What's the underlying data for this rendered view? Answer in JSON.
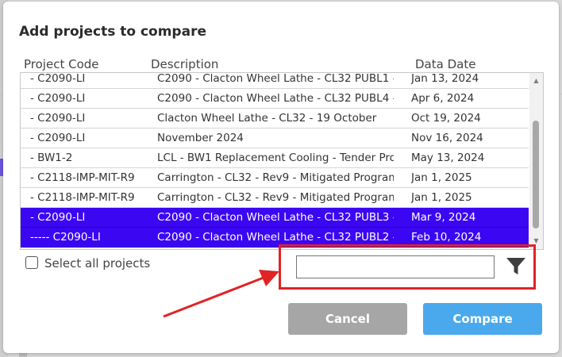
{
  "dialog": {
    "title": "Add projects to compare",
    "columns": {
      "code": "Project Code",
      "description": "Description",
      "date": "Data Date"
    },
    "rows": [
      {
        "code": "- C2090-LI",
        "description": "C2090 - Clacton Wheel Lathe - CL32 PUBL1 -",
        "date": "Jan 13, 2024",
        "selected": false
      },
      {
        "code": "- C2090-LI",
        "description": "C2090 - Clacton Wheel Lathe - CL32 PUBL4 -",
        "date": "Apr 6, 2024",
        "selected": false
      },
      {
        "code": "- C2090-LI",
        "description": "Clacton Wheel Lathe - CL32 - 19 October",
        "date": "Oct 19, 2024",
        "selected": false
      },
      {
        "code": "- C2090-LI",
        "description": "November 2024",
        "date": "Nov 16, 2024",
        "selected": false
      },
      {
        "code": "- BW1-2",
        "description": "LCL - BW1 Replacement Cooling - Tender Prog",
        "date": "May 13, 2024",
        "selected": false
      },
      {
        "code": "- C2118-IMP-MIT-R9",
        "description": "Carrington - CL32 - Rev9 - Mitigated Programm",
        "date": "Jan 1, 2025",
        "selected": false
      },
      {
        "code": "- C2118-IMP-MIT-R9",
        "description": "Carrington - CL32 - Rev9 - Mitigated Programm",
        "date": "Jan 1, 2025",
        "selected": false
      },
      {
        "code": "- C2090-LI",
        "description": "C2090 - Clacton Wheel Lathe - CL32 PUBL3 -",
        "date": "Mar 9, 2024",
        "selected": true
      },
      {
        "code": "----- C2090-LI",
        "description": "C2090 - Clacton Wheel Lathe - CL32 PUBL2 -",
        "date": "Feb 10, 2024",
        "selected": true
      }
    ],
    "select_all_label": "Select all projects",
    "select_all_checked": false,
    "filter_value": "",
    "filter_icon": "filter-funnel-icon",
    "buttons": {
      "cancel": "Cancel",
      "compare": "Compare"
    }
  },
  "colors": {
    "selected_row": "#3b07f2",
    "annotation": "#e02323",
    "compare_button": "#4aa9ec",
    "cancel_button": "#a6a6a6"
  }
}
